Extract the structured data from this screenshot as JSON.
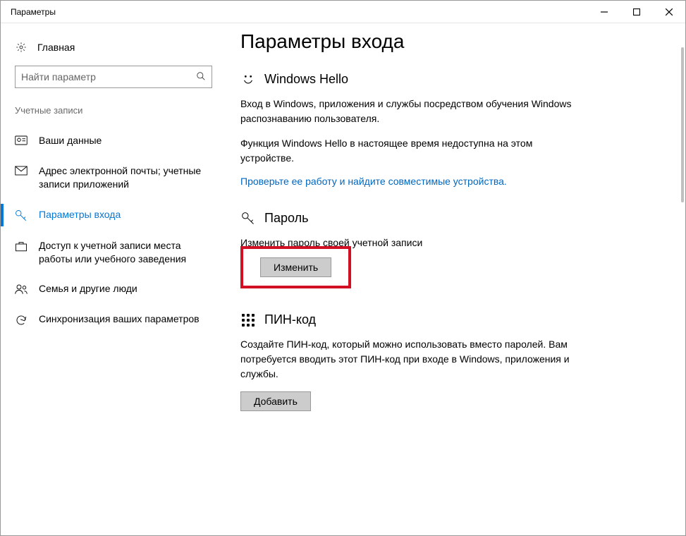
{
  "window": {
    "title": "Параметры"
  },
  "sidebar": {
    "home": "Главная",
    "search_placeholder": "Найти параметр",
    "section": "Учетные записи",
    "items": [
      {
        "label": "Ваши данные"
      },
      {
        "label": "Адрес электронной почты; учетные записи приложений"
      },
      {
        "label": "Параметры входа"
      },
      {
        "label": "Доступ к учетной записи места работы или учебного заведения"
      },
      {
        "label": "Семья и другие люди"
      },
      {
        "label": "Синхронизация ваших параметров"
      }
    ]
  },
  "content": {
    "title": "Параметры входа",
    "hello": {
      "heading": "Windows Hello",
      "p1": "Вход в Windows, приложения и службы посредством обучения Windows распознаванию пользователя.",
      "p2": "Функция Windows Hello в настоящее время недоступна на этом устройстве.",
      "link": "Проверьте ее работу и найдите совместимые устройства."
    },
    "password": {
      "heading": "Пароль",
      "p1": "Изменить пароль своей учетной записи",
      "button": "Изменить"
    },
    "pin": {
      "heading": "ПИН-код",
      "p1": "Создайте ПИН-код, который можно использовать вместо паролей. Вам потребуется вводить этот ПИН-код при входе в Windows, приложения и службы.",
      "button": "Добавить"
    }
  }
}
